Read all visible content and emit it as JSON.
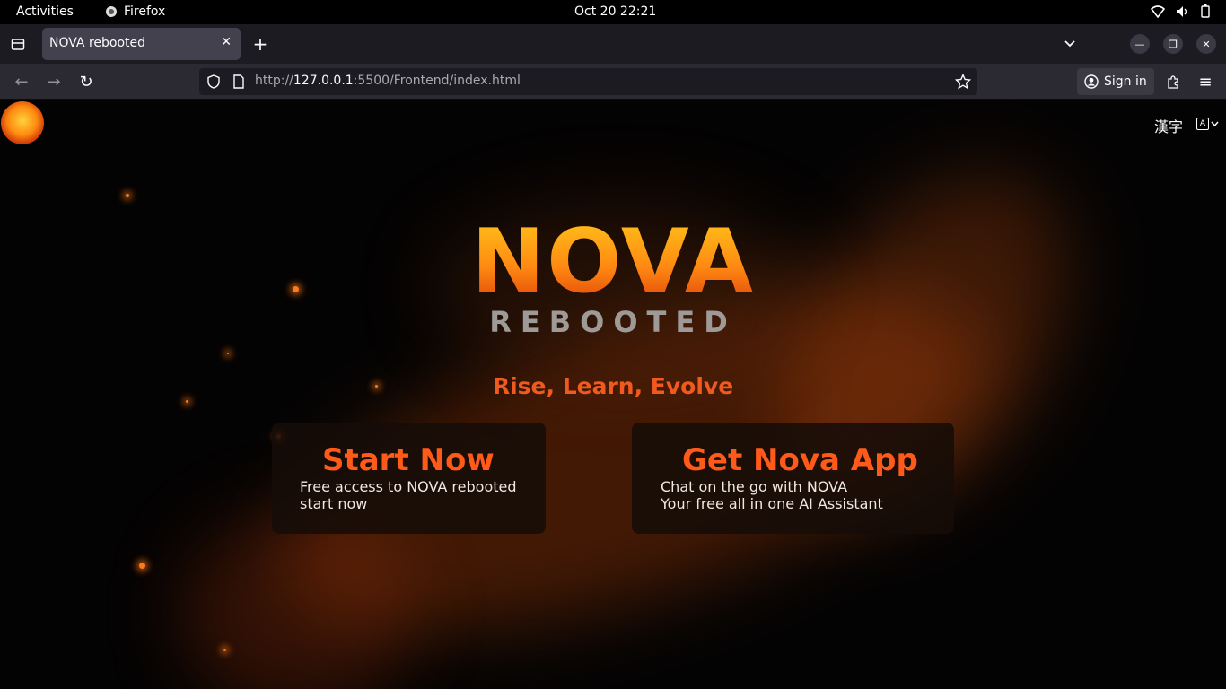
{
  "system": {
    "activities": "Activities",
    "app_name": "Firefox",
    "clock": "Oct 20  22:21"
  },
  "browser": {
    "tab_title": "NOVA rebooted",
    "url_prefix": "http://",
    "url_host": "127.0.0.1",
    "url_rest": ":5500/Frontend/index.html",
    "sign_in": "Sign in"
  },
  "page": {
    "lang_label": "漢字",
    "brand_title": "NOVA",
    "brand_sub": "REBOOTED",
    "tagline": "Rise, Learn, Evolve",
    "cards": [
      {
        "title": "Start Now",
        "line1": "Free access to NOVA rebooted",
        "line2": "start now"
      },
      {
        "title": "Get Nova App",
        "line1": "Chat on the go with NOVA",
        "line2": "Your free all in one AI Assistant"
      }
    ]
  },
  "colors": {
    "accent": "#ff5a1a",
    "brand_gold": "#ffc21a",
    "background": "#040303"
  }
}
